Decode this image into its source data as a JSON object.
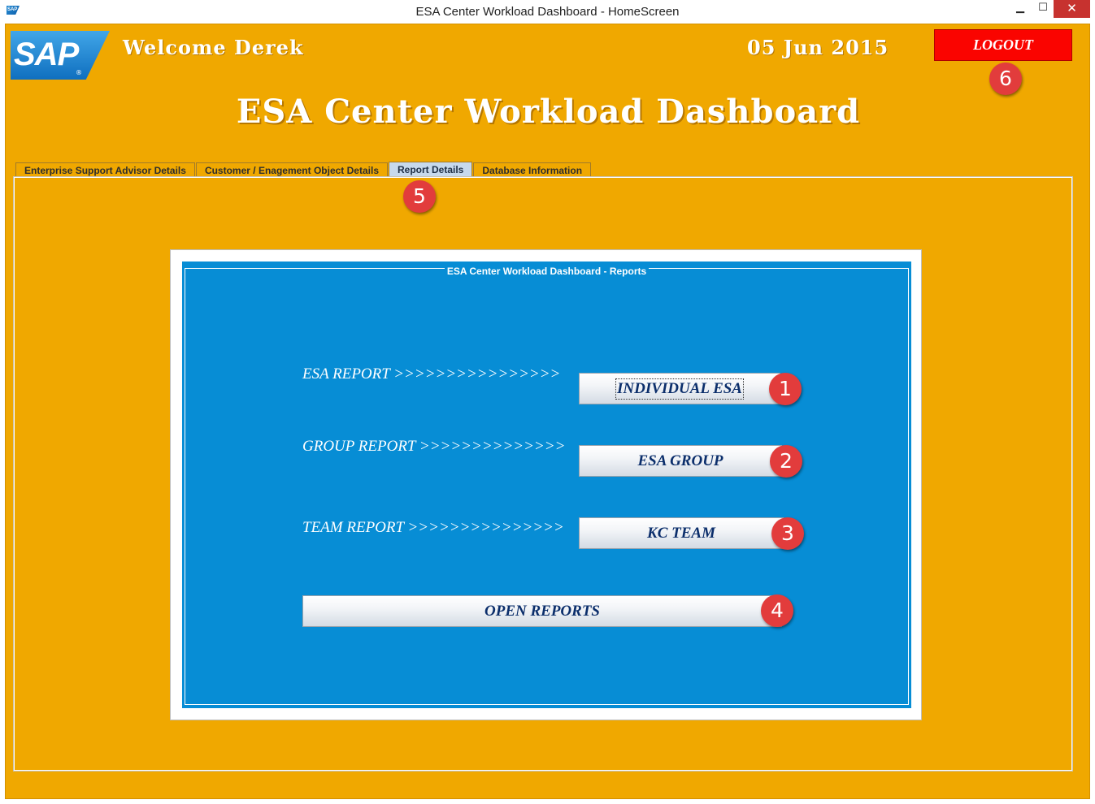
{
  "window": {
    "title": "ESA Center Workload Dashboard - HomeScreen",
    "app_icon_text": "SAP",
    "minimize": "▁",
    "maximize": "☐",
    "close": "✕"
  },
  "header": {
    "logo": "SAP",
    "logo_mark": "®",
    "welcome": "Welcome Derek",
    "date": "05 Jun 2015",
    "logout_label": "LOGOUT",
    "main_title": "ESA Center Workload Dashboard"
  },
  "tabs": [
    {
      "label": "Enterprise Support Advisor Details"
    },
    {
      "label": "Customer / Enagement Object Details"
    },
    {
      "label": "Report Details"
    },
    {
      "label": "Database Information"
    }
  ],
  "reports_panel": {
    "title": "ESA Center Workload Dashboard - Reports",
    "rows": [
      {
        "label": "ESA REPORT >>>>>>>>>>>>>>>>",
        "button": "INDIVIDUAL ESA"
      },
      {
        "label": "GROUP REPORT >>>>>>>>>>>>>>",
        "button": "ESA GROUP"
      },
      {
        "label": "TEAM REPORT >>>>>>>>>>>>>>>",
        "button": "KC TEAM"
      }
    ],
    "open_reports": "OPEN REPORTS"
  },
  "badges": [
    "1",
    "2",
    "3",
    "4",
    "5",
    "6"
  ],
  "colors": {
    "background": "#f0a800",
    "logout": "#fa0400",
    "panel": "#078dd5",
    "badge": "#e23c3c"
  }
}
